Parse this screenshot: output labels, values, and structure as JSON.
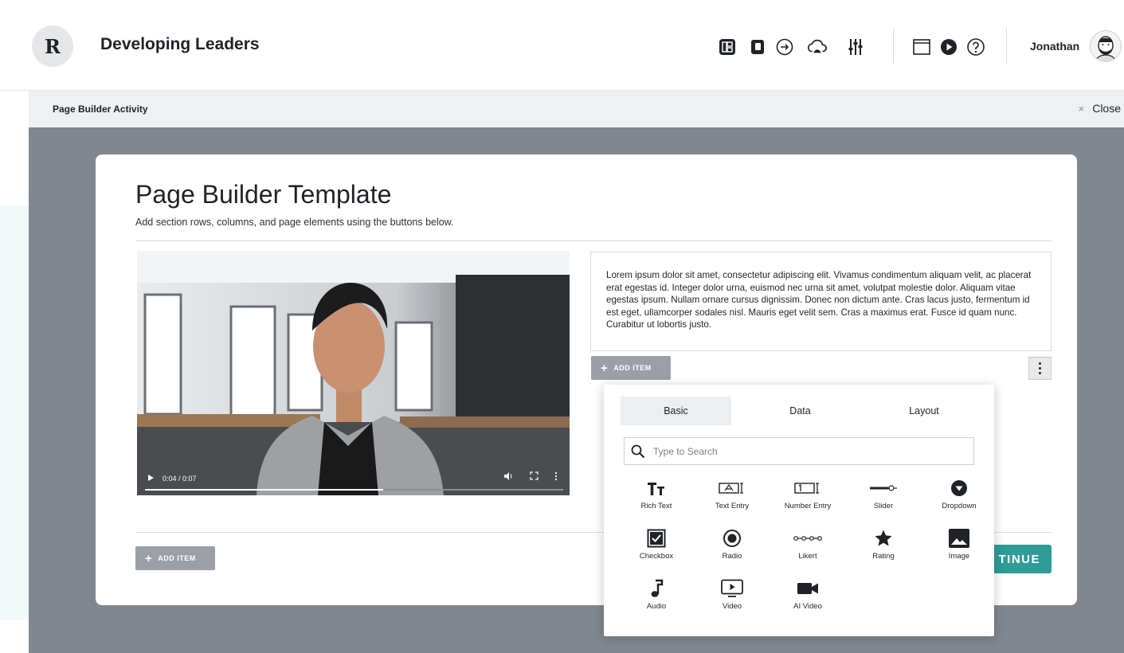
{
  "header": {
    "logo_letter": "R",
    "app_title": "Developing Leaders",
    "user_name": "Jonathan",
    "tool_icons": [
      "layout-icon",
      "copy-icon",
      "forward-icon",
      "cloud-icon",
      "sliders-icon"
    ],
    "view_icons": [
      "window-icon",
      "play-icon",
      "help-icon"
    ]
  },
  "subbar": {
    "title": "Page Builder Activity",
    "close_label": "Close",
    "close_x": "×"
  },
  "page": {
    "title": "Page Builder Template",
    "subtitle": "Add section rows, columns, and page elements using the buttons below."
  },
  "video": {
    "time": "0:04 / 0:07",
    "progress": 0.57
  },
  "text_block": "Lorem ipsum dolor sit amet, consectetur adipiscing elit. Vivamus condimentum aliquam velit, ac placerat erat egestas id. Integer dolor urna, euismod nec urna sit amet, volutpat molestie dolor. Aliquam vitae egestas ipsum. Nullam ornare cursus dignissim. Donec non dictum ante. Cras lacus justo, fermentum id est eget, ullamcorper sodales nisl. Mauris eget velit sem. Cras a maximus erat. Fusce id quam nunc. Curabitur ut lobortis justo.",
  "buttons": {
    "add_item": "ADD ITEM",
    "plus": "+",
    "continue": "TINUE"
  },
  "picker": {
    "tabs": [
      "Basic",
      "Data",
      "Layout"
    ],
    "active_tab": "Basic",
    "search_placeholder": "Type to Search",
    "items": [
      "Rich Text",
      "Text Entry",
      "Number Entry",
      "Slider",
      "Dropdown",
      "Checkbox",
      "Radio",
      "Likert",
      "Rating",
      "Image",
      "Audio",
      "Video",
      "AI Video"
    ]
  },
  "colors": {
    "accent": "#2f9c97",
    "overlay": "#82868e",
    "add_button": "#9aa0a6",
    "text": "#1f2328"
  }
}
